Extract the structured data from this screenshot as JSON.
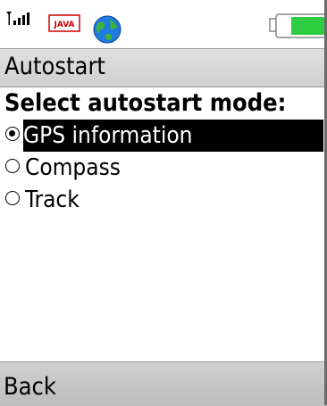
{
  "status_bar": {
    "signal_icon": "signal-strength-icon",
    "java_icon": "java-icon",
    "java_label": "JAVA",
    "globe_icon": "globe-icon",
    "battery_icon": "battery-icon",
    "battery_color": "#2ecc40"
  },
  "title_bar": {
    "title": "Autostart"
  },
  "main": {
    "prompt": "Select autostart mode:",
    "options": [
      {
        "label": "GPS information",
        "checked": true,
        "highlighted": true
      },
      {
        "label": "Compass",
        "checked": false,
        "highlighted": false
      },
      {
        "label": "Track",
        "checked": false,
        "highlighted": false
      }
    ]
  },
  "softkeys": {
    "left": "Back"
  }
}
